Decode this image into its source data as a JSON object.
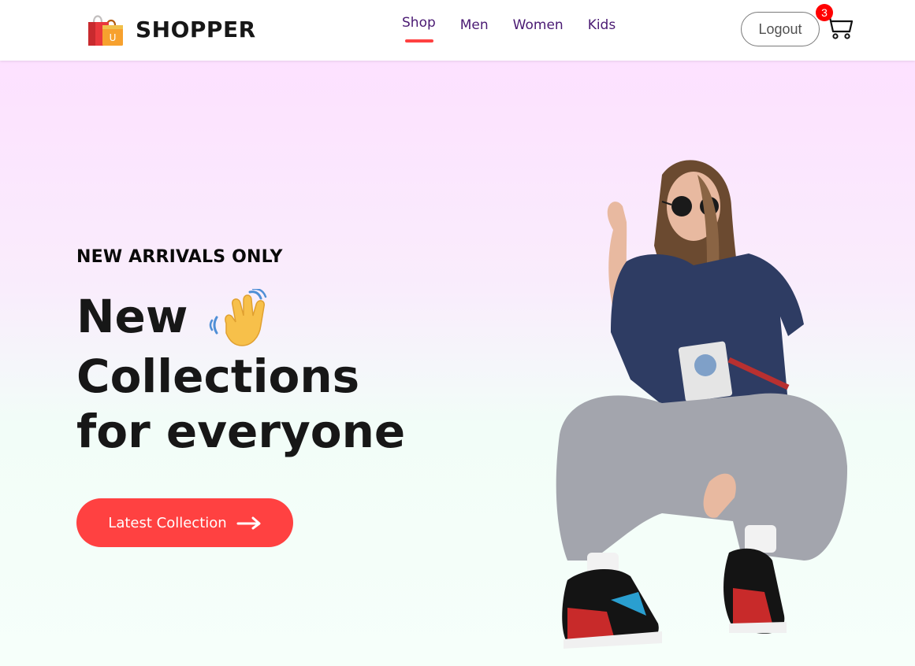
{
  "navbar": {
    "brand": "SHOPPER",
    "logo_icon": "shopping-bag-logo-icon",
    "menu": [
      {
        "label": "Shop",
        "active": true
      },
      {
        "label": "Men",
        "active": false
      },
      {
        "label": "Women",
        "active": false
      },
      {
        "label": "Kids",
        "active": false
      }
    ],
    "logout_label": "Logout",
    "cart_icon": "cart-icon",
    "cart_count": "3"
  },
  "hero": {
    "eyebrow": "NEW ARRIVALS ONLY",
    "headline_lines": [
      "New",
      "Collections",
      "for everyone"
    ],
    "hand_icon": "waving-hand-icon",
    "cta_label": "Latest Collection",
    "cta_icon": "arrow-right-icon",
    "image_icon": "hero-model-image"
  },
  "colors": {
    "accent": "#ff4141",
    "nav_text": "#4a1a73",
    "heading": "#171717",
    "badge": "#ff0000",
    "hero_gradient_top": "#fde1ff",
    "hero_gradient_bottom": "#f6fffa"
  }
}
